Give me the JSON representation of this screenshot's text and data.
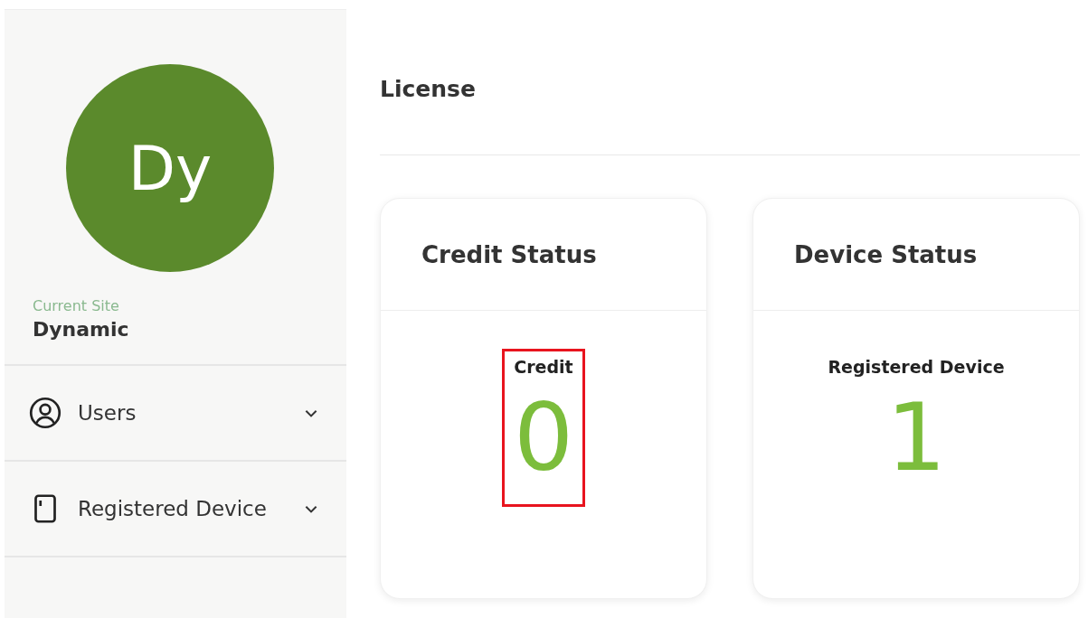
{
  "sidebar": {
    "avatar_initials": "Dy",
    "site_label": "Current Site",
    "site_name": "Dynamic",
    "items": [
      {
        "label": "Users",
        "kind": "user",
        "expanded": false
      },
      {
        "label": "Registered Device",
        "kind": "device",
        "expanded": false
      }
    ]
  },
  "page_title": "License",
  "cards": [
    {
      "title": "Credit Status",
      "stat_label": "Credit",
      "stat_value": "0",
      "highlighted": true
    },
    {
      "title": "Device Status",
      "stat_label": "Registered Device",
      "stat_value": "1",
      "highlighted": false
    }
  ]
}
